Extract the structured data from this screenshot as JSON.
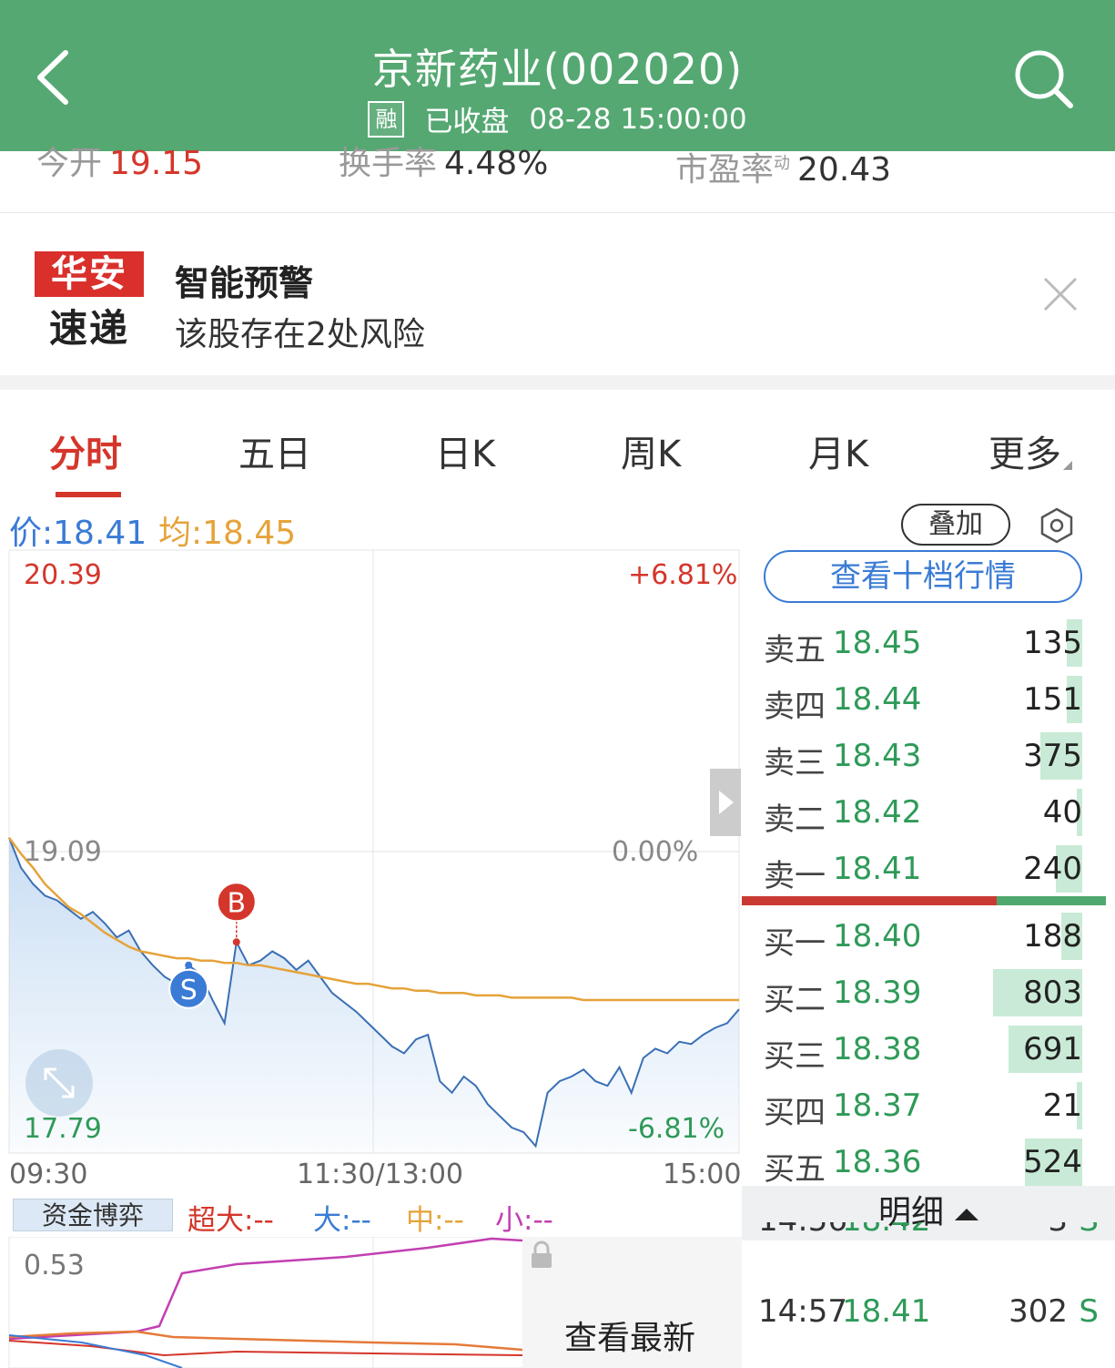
{
  "header": {
    "title": "京新药业(002020)",
    "badge": "融",
    "status": "已收盘",
    "datetime": "08-28 15:00:00"
  },
  "stats": {
    "open_label": "今开",
    "open_value": "19.15",
    "turnover_label": "换手率",
    "turnover_value": "4.48%",
    "pe_label": "市盈率",
    "pe_sup": "动",
    "pe_value": "20.43"
  },
  "alert": {
    "logo_top": "华安",
    "logo_bottom": "速递",
    "title": "智能预警",
    "description": "该股存在2处风险"
  },
  "tabs": [
    "分时",
    "五日",
    "日K",
    "周K",
    "月K",
    "更多"
  ],
  "price_bar": {
    "price_text": "价:18.41",
    "avg_text": "均:18.45",
    "overlay_label": "叠加"
  },
  "chart_data": {
    "type": "line",
    "y_high": "20.39",
    "y_mid": "19.09",
    "y_low": "17.79",
    "pct_high": "+6.81%",
    "pct_mid": "0.00%",
    "pct_low": "-6.81%",
    "x_labels": [
      "09:30",
      "11:30/13:00",
      "15:00"
    ],
    "ylim": [
      17.79,
      20.39
    ],
    "prev_close": 19.09,
    "price_series": [
      19.15,
      19.02,
      18.95,
      18.9,
      18.88,
      18.84,
      18.8,
      18.83,
      18.78,
      18.72,
      18.75,
      18.66,
      18.6,
      18.55,
      18.52,
      18.6,
      18.56,
      18.45,
      18.35,
      18.7,
      18.6,
      18.62,
      18.66,
      18.63,
      18.58,
      18.62,
      18.55,
      18.48,
      18.44,
      18.4,
      18.35,
      18.3,
      18.25,
      18.22,
      18.28,
      18.3,
      18.1,
      18.05,
      18.12,
      18.08,
      18.0,
      17.95,
      17.9,
      17.88,
      17.82,
      18.05,
      18.1,
      18.12,
      18.15,
      18.1,
      18.08,
      18.16,
      18.05,
      18.2,
      18.24,
      18.22,
      18.27,
      18.26,
      18.3,
      18.33,
      18.35,
      18.41
    ],
    "avg_series": [
      19.15,
      19.08,
      19.02,
      18.95,
      18.9,
      18.85,
      18.82,
      18.78,
      18.74,
      18.71,
      18.68,
      18.66,
      18.65,
      18.64,
      18.63,
      18.63,
      18.62,
      18.62,
      18.61,
      18.61,
      18.6,
      18.6,
      18.59,
      18.58,
      18.57,
      18.56,
      18.55,
      18.54,
      18.53,
      18.52,
      18.52,
      18.51,
      18.5,
      18.5,
      18.49,
      18.49,
      18.48,
      18.48,
      18.48,
      18.47,
      18.47,
      18.47,
      18.46,
      18.46,
      18.46,
      18.46,
      18.46,
      18.46,
      18.45,
      18.45,
      18.45,
      18.45,
      18.45,
      18.45,
      18.45,
      18.45,
      18.45,
      18.45,
      18.45,
      18.45,
      18.45,
      18.45
    ],
    "markers": [
      {
        "label": "S",
        "index": 15
      },
      {
        "label": "B",
        "index": 19
      }
    ]
  },
  "order_book": {
    "ten_level_label": "查看十档行情",
    "asks": [
      {
        "label": "卖五",
        "price": "18.45",
        "volume": "135",
        "share": 0.03
      },
      {
        "label": "卖四",
        "price": "18.44",
        "volume": "151",
        "share": 0.03
      },
      {
        "label": "卖三",
        "price": "18.43",
        "volume": "375",
        "share": 0.08
      },
      {
        "label": "卖二",
        "price": "18.42",
        "volume": "40",
        "share": 0.01
      },
      {
        "label": "卖一",
        "price": "18.41",
        "volume": "240",
        "share": 0.05
      }
    ],
    "bids": [
      {
        "label": "买一",
        "price": "18.40",
        "volume": "188",
        "share": 0.04
      },
      {
        "label": "买二",
        "price": "18.39",
        "volume": "803",
        "share": 0.17
      },
      {
        "label": "买三",
        "price": "18.38",
        "volume": "691",
        "share": 0.14
      },
      {
        "label": "买四",
        "price": "18.37",
        "volume": "21",
        "share": 0.01
      },
      {
        "label": "买五",
        "price": "18.36",
        "volume": "524",
        "share": 0.11
      }
    ],
    "detail_label": "明细",
    "ticks": [
      {
        "time": "14:56",
        "price": "18.42",
        "volume": "3",
        "side": "S"
      },
      {
        "time": "14:57",
        "price": "18.41",
        "volume": "302",
        "side": "S"
      }
    ]
  },
  "fund_flow": {
    "label": "资金博弈",
    "super_large": "超大:--",
    "large": "大:--",
    "medium": "中:--",
    "small": "小:--",
    "value": "0.53",
    "locked_text": "查看最新"
  },
  "colors": {
    "header_green": "#55a872",
    "up_red": "#d4362b",
    "down_green": "#2f9a58",
    "price_blue": "#3a7bd5",
    "avg_orange": "#e5a33a"
  }
}
